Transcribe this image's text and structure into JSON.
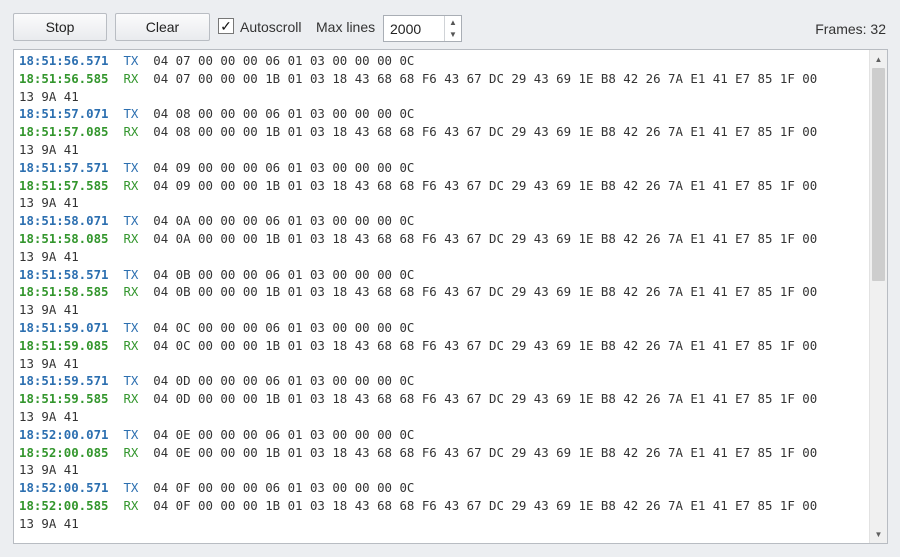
{
  "toolbar": {
    "stop_label": "Stop",
    "clear_label": "Clear",
    "autoscroll_checked": true,
    "autoscroll_check_glyph": "✓",
    "autoscroll_label": "Autoscroll",
    "max_lines_label": "Max lines",
    "max_lines_value": "2000",
    "frames_text": "Frames: 32"
  },
  "colors": {
    "tx": "#2c6fb0",
    "rx": "#33962d"
  },
  "icons": {
    "spin_up": "chevron-up-icon",
    "spin_down": "chevron-down-icon",
    "scroll_up": "scroll-up-arrow-icon",
    "scroll_down": "scroll-down-arrow-icon"
  },
  "log": [
    {
      "time": "18:51:56.571",
      "dir": "TX",
      "data": "04 07 00 00 00 06 01 03 00 00 00 0C"
    },
    {
      "time": "18:51:56.585",
      "dir": "RX",
      "data": "04 07 00 00 00 1B 01 03 18 43 68 68 F6 43 67 DC 29 43 69 1E B8 42 26 7A E1 41 E7 85 1F 00",
      "cont": "13 9A 41"
    },
    {
      "time": "18:51:57.071",
      "dir": "TX",
      "data": "04 08 00 00 00 06 01 03 00 00 00 0C"
    },
    {
      "time": "18:51:57.085",
      "dir": "RX",
      "data": "04 08 00 00 00 1B 01 03 18 43 68 68 F6 43 67 DC 29 43 69 1E B8 42 26 7A E1 41 E7 85 1F 00",
      "cont": "13 9A 41"
    },
    {
      "time": "18:51:57.571",
      "dir": "TX",
      "data": "04 09 00 00 00 06 01 03 00 00 00 0C"
    },
    {
      "time": "18:51:57.585",
      "dir": "RX",
      "data": "04 09 00 00 00 1B 01 03 18 43 68 68 F6 43 67 DC 29 43 69 1E B8 42 26 7A E1 41 E7 85 1F 00",
      "cont": "13 9A 41"
    },
    {
      "time": "18:51:58.071",
      "dir": "TX",
      "data": "04 0A 00 00 00 06 01 03 00 00 00 0C"
    },
    {
      "time": "18:51:58.085",
      "dir": "RX",
      "data": "04 0A 00 00 00 1B 01 03 18 43 68 68 F6 43 67 DC 29 43 69 1E B8 42 26 7A E1 41 E7 85 1F 00",
      "cont": "13 9A 41"
    },
    {
      "time": "18:51:58.571",
      "dir": "TX",
      "data": "04 0B 00 00 00 06 01 03 00 00 00 0C"
    },
    {
      "time": "18:51:58.585",
      "dir": "RX",
      "data": "04 0B 00 00 00 1B 01 03 18 43 68 68 F6 43 67 DC 29 43 69 1E B8 42 26 7A E1 41 E7 85 1F 00",
      "cont": "13 9A 41"
    },
    {
      "time": "18:51:59.071",
      "dir": "TX",
      "data": "04 0C 00 00 00 06 01 03 00 00 00 0C"
    },
    {
      "time": "18:51:59.085",
      "dir": "RX",
      "data": "04 0C 00 00 00 1B 01 03 18 43 68 68 F6 43 67 DC 29 43 69 1E B8 42 26 7A E1 41 E7 85 1F 00",
      "cont": "13 9A 41"
    },
    {
      "time": "18:51:59.571",
      "dir": "TX",
      "data": "04 0D 00 00 00 06 01 03 00 00 00 0C"
    },
    {
      "time": "18:51:59.585",
      "dir": "RX",
      "data": "04 0D 00 00 00 1B 01 03 18 43 68 68 F6 43 67 DC 29 43 69 1E B8 42 26 7A E1 41 E7 85 1F 00",
      "cont": "13 9A 41"
    },
    {
      "time": "18:52:00.071",
      "dir": "TX",
      "data": "04 0E 00 00 00 06 01 03 00 00 00 0C"
    },
    {
      "time": "18:52:00.085",
      "dir": "RX",
      "data": "04 0E 00 00 00 1B 01 03 18 43 68 68 F6 43 67 DC 29 43 69 1E B8 42 26 7A E1 41 E7 85 1F 00",
      "cont": "13 9A 41"
    },
    {
      "time": "18:52:00.571",
      "dir": "TX",
      "data": "04 0F 00 00 00 06 01 03 00 00 00 0C"
    },
    {
      "time": "18:52:00.585",
      "dir": "RX",
      "data": "04 0F 00 00 00 1B 01 03 18 43 68 68 F6 43 67 DC 29 43 69 1E B8 42 26 7A E1 41 E7 85 1F 00",
      "cont": "13 9A 41"
    }
  ]
}
